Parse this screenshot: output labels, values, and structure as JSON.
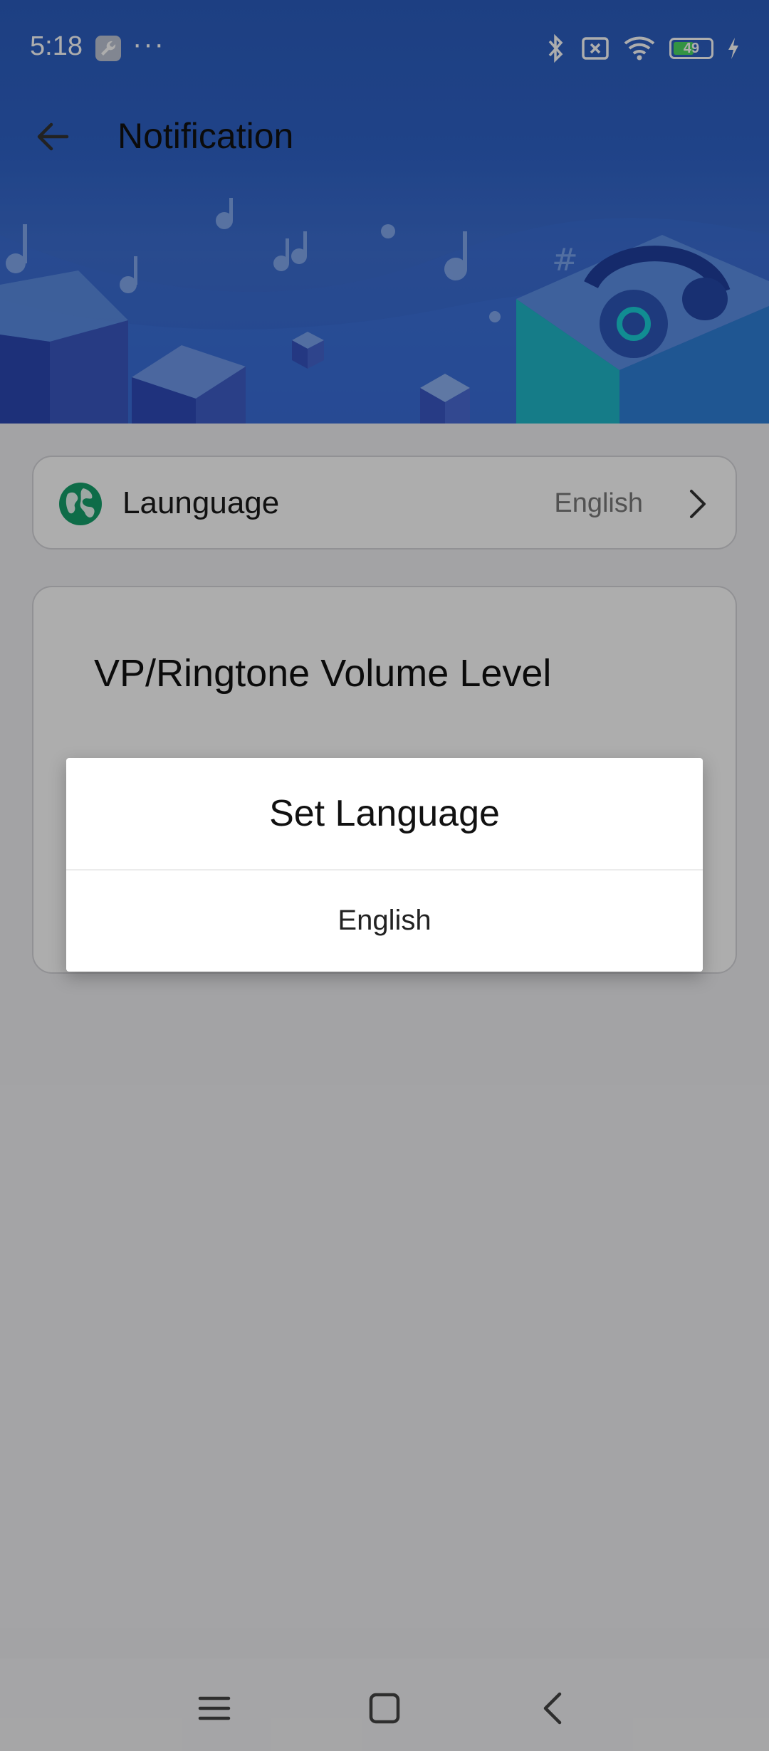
{
  "status_bar": {
    "time": "5:18",
    "dots": "···",
    "battery_level": "49",
    "icons": [
      "wrench-app-icon",
      "bluetooth-icon",
      "no-sim-icon",
      "wifi-icon",
      "battery-icon",
      "charging-icon"
    ]
  },
  "header": {
    "title": "Notification",
    "back_icon": "arrow-left-icon"
  },
  "language_row": {
    "label": "Launguage",
    "value": "English",
    "icon": "globe-icon",
    "chevron": "chevron-right-icon"
  },
  "volume_card": {
    "title": "VP/Ringtone Volume Level"
  },
  "dialog": {
    "title": "Set Language",
    "options": [
      "English"
    ]
  },
  "nav_bar": {
    "icons": [
      "menu-icon",
      "home-icon",
      "back-nav-icon"
    ]
  },
  "colors": {
    "banner": "#2f63c9",
    "globe": "#15a06b",
    "scrim": "rgba(0,0,0,0.32)"
  }
}
